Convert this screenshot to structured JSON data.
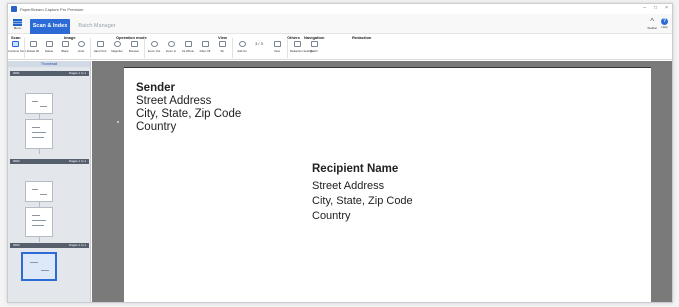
{
  "window": {
    "title": "PaperStream Capture Pro Premium"
  },
  "menu": {
    "label": "Menu",
    "tab_active": "Scan & Index",
    "tab_inactive": "Batch Manager"
  },
  "top_right": {
    "toolbar_label": "Toolbar",
    "help_label": "Help"
  },
  "ribbon": {
    "groups": [
      "Scan",
      "Image",
      "Operation mode",
      "View",
      "Others",
      "Navigation",
      "Redaction"
    ],
    "buttons": [
      {
        "label": "Continue Scan",
        "icon": "scanner-icon"
      },
      {
        "label": "Rotate 90",
        "icon": "rotate-icon"
      },
      {
        "label": "Delete",
        "icon": "delete-icon"
      },
      {
        "label": "Blank",
        "icon": "blank-page-icon"
      },
      {
        "label": "Undo",
        "icon": "undo-icon"
      },
      {
        "label": "Hand Tool",
        "icon": "hand-icon"
      },
      {
        "label": "Magnifier",
        "icon": "magnifier-icon"
      },
      {
        "label": "Browser",
        "icon": "browser-icon"
      },
      {
        "label": "Zoom Out",
        "icon": "zoom-out-icon"
      },
      {
        "label": "Zoom In",
        "icon": "zoom-in-icon"
      },
      {
        "label": "Fit Whole",
        "icon": "fit-whole-icon"
      },
      {
        "label": "Filter Off",
        "icon": "filter-icon"
      },
      {
        "label": "Tel",
        "icon": "tel-icon"
      },
      {
        "label": "Add Up",
        "icon": "add-up-icon"
      },
      {
        "label": "View",
        "icon": "view-icon"
      },
      {
        "label": "Redaction Settings",
        "icon": "redaction-icon"
      },
      {
        "label": "Batch",
        "icon": "batch-icon"
      }
    ],
    "navigation": {
      "counter": "3 / 3"
    }
  },
  "sidebar": {
    "title": "Thumbnail",
    "pages": [
      {
        "doc": "0001",
        "info": "Pages 1 to 1"
      },
      {
        "doc": "0002",
        "info": "Pages 1 to 1"
      },
      {
        "doc": "0003",
        "info": "Pages 1 to 1"
      }
    ]
  },
  "document": {
    "sender": {
      "name": "Sender",
      "street": "Street Address",
      "city": "City, State, Zip Code",
      "country": "Country"
    },
    "recipient": {
      "name": "Recipient Name",
      "street": "Street Address",
      "city": "City, State, Zip Code",
      "country": "Country"
    }
  },
  "colors": {
    "accent": "#2c6bd6",
    "viewer_bg": "#7a7a7a",
    "sidebar_bg": "#e3e7ec"
  }
}
